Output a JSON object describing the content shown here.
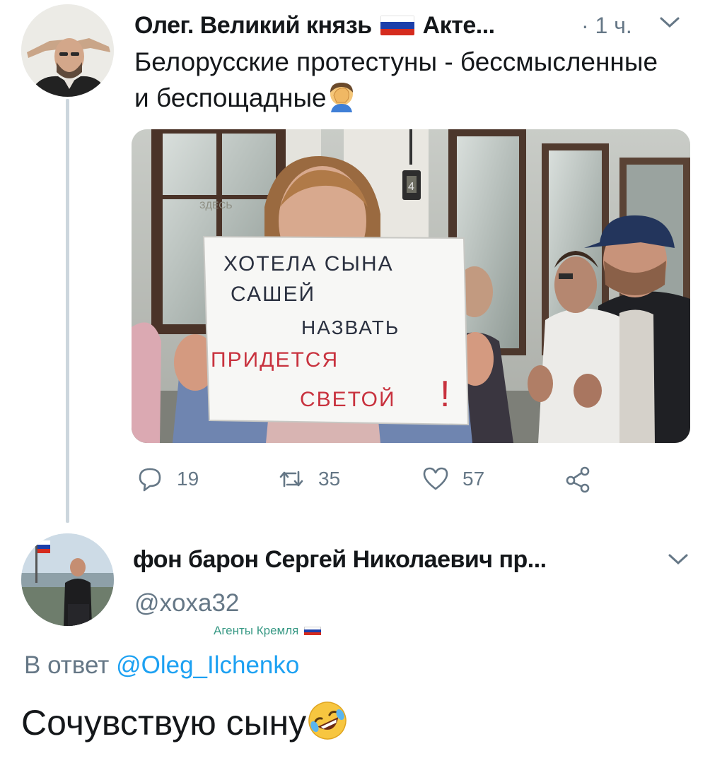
{
  "tweet": {
    "author_name": "Олег. Великий князь",
    "author_suffix": "Акте...",
    "time": "· 1 ч.",
    "text": "Белорусские протестуны - бессмысленные и беспощадные",
    "text_emoji": "face-palm-emoji",
    "photo_sign": {
      "line1": "ХОТЕЛА СЫНА",
      "line2": "САШЕЙ",
      "line3": "НАЗВАТЬ",
      "line4": "ПРИДЕТСЯ",
      "line5": "СВЕТОЙ",
      "mark": "!"
    },
    "photo_door_number": "4",
    "photo_window_text": "ЗДЕСЬ",
    "actions": {
      "replies": "19",
      "retweets": "35",
      "likes": "57"
    }
  },
  "reply": {
    "author_name": "фон барон Сергей Николаевич пр...",
    "handle": "@xoxa32",
    "tag": "Агенты Кремля",
    "reply_prefix": "В ответ",
    "reply_mention": "@Oleg_Ilchenko",
    "text": "Сочувствую сыну",
    "text_emoji": "rolling-on-the-floor-laughing-emoji"
  },
  "colors": {
    "text": "#14171a",
    "secondary": "#657786",
    "link": "#1da1f2",
    "thread_line": "#ccd6dd",
    "tag_green": "#3a9a86",
    "flag_white": "#ffffff",
    "flag_blue": "#1c3faa",
    "flag_red": "#d52b1e"
  }
}
